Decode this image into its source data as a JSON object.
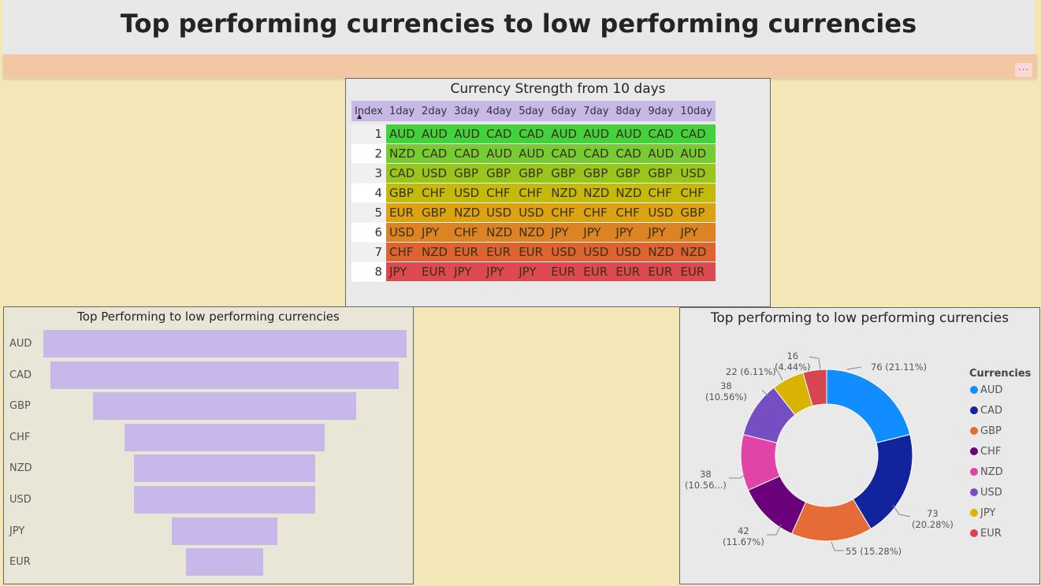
{
  "page_title": "Top performing currencies to low performing currencies",
  "more_label": "...",
  "table": {
    "title": "Currency Strength from 10 days",
    "headers": [
      "Index",
      "1day",
      "2day",
      "3day",
      "4day",
      "5day",
      "6day",
      "7day",
      "8day",
      "9day",
      "10day"
    ],
    "rows": [
      {
        "index": "1",
        "cells": [
          "AUD",
          "AUD",
          "AUD",
          "CAD",
          "CAD",
          "AUD",
          "AUD",
          "AUD",
          "CAD",
          "CAD"
        ]
      },
      {
        "index": "2",
        "cells": [
          "NZD",
          "CAD",
          "CAD",
          "AUD",
          "AUD",
          "CAD",
          "CAD",
          "CAD",
          "AUD",
          "AUD"
        ]
      },
      {
        "index": "3",
        "cells": [
          "CAD",
          "USD",
          "GBP",
          "GBP",
          "GBP",
          "GBP",
          "GBP",
          "GBP",
          "GBP",
          "USD"
        ]
      },
      {
        "index": "4",
        "cells": [
          "GBP",
          "CHF",
          "USD",
          "CHF",
          "CHF",
          "NZD",
          "NZD",
          "NZD",
          "CHF",
          "CHF"
        ]
      },
      {
        "index": "5",
        "cells": [
          "EUR",
          "GBP",
          "NZD",
          "USD",
          "USD",
          "CHF",
          "CHF",
          "CHF",
          "USD",
          "GBP"
        ]
      },
      {
        "index": "6",
        "cells": [
          "USD",
          "JPY",
          "CHF",
          "NZD",
          "NZD",
          "JPY",
          "JPY",
          "JPY",
          "JPY",
          "JPY"
        ]
      },
      {
        "index": "7",
        "cells": [
          "CHF",
          "NZD",
          "EUR",
          "EUR",
          "EUR",
          "USD",
          "USD",
          "USD",
          "NZD",
          "NZD"
        ]
      },
      {
        "index": "8",
        "cells": [
          "JPY",
          "EUR",
          "JPY",
          "JPY",
          "JPY",
          "EUR",
          "EUR",
          "EUR",
          "EUR",
          "EUR"
        ]
      }
    ],
    "row_colors": [
      "#43d13e",
      "#78cc33",
      "#98c61d",
      "#c4ba0a",
      "#dba211",
      "#dc8424",
      "#de6332",
      "#dc4950"
    ]
  },
  "chart_data": [
    {
      "type": "bar",
      "style": "funnel",
      "title": "Top Performing to low performing currencies",
      "categories": [
        "AUD",
        "CAD",
        "GBP",
        "CHF",
        "NZD",
        "USD",
        "JPY",
        "EUR"
      ],
      "values": [
        76,
        73,
        55,
        42,
        38,
        38,
        22,
        16
      ],
      "color": "#c8b8ea"
    },
    {
      "type": "pie",
      "variant": "donut",
      "title": "Top performing to low performing currencies",
      "legend_title": "Currencies",
      "legend_position": "right",
      "labels": [
        "AUD",
        "CAD",
        "GBP",
        "CHF",
        "NZD",
        "USD",
        "JPY",
        "EUR"
      ],
      "values": [
        76,
        73,
        55,
        42,
        38,
        38,
        22,
        16
      ],
      "colors": [
        "#118dff",
        "#12239e",
        "#e66c37",
        "#6b007b",
        "#e044a7",
        "#744ec2",
        "#d9b300",
        "#d64550"
      ],
      "annotations": [
        "76 (21.11%)",
        "73\n(20.28%)",
        "55 (15.28%)",
        "42\n(11.67%)",
        "38\n(10.56...)",
        "38\n(10.56%)",
        "22 (6.11%)",
        "16\n(4.44%)"
      ]
    }
  ]
}
